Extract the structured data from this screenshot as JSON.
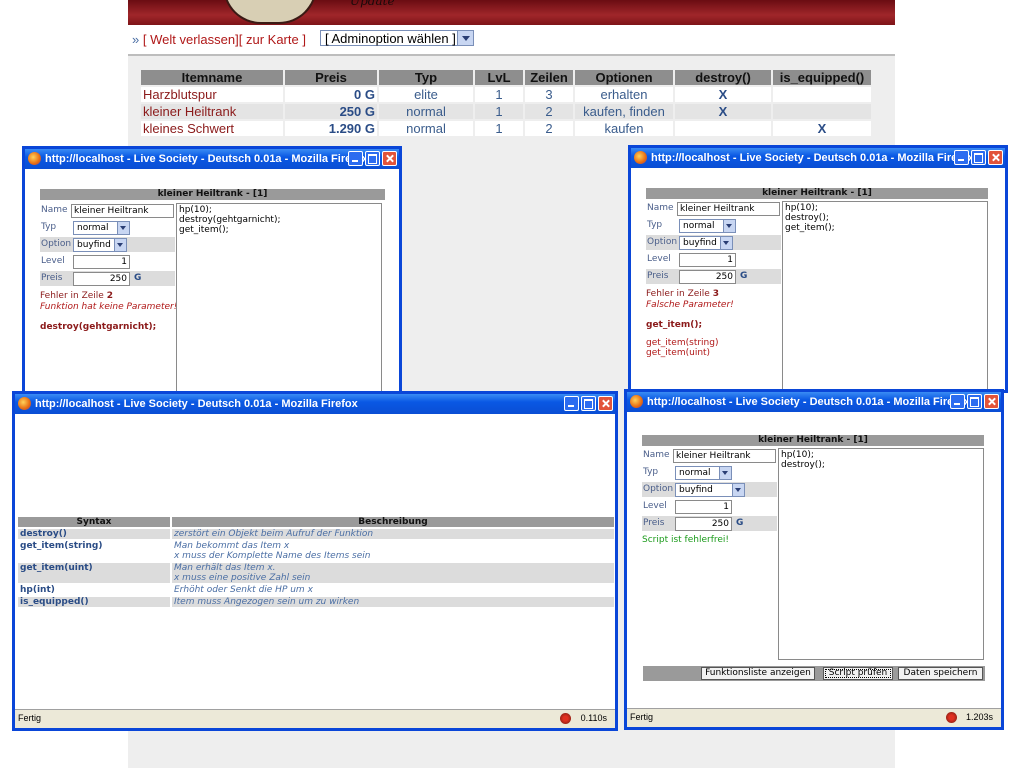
{
  "header": {
    "logo_text": "Update"
  },
  "nav": {
    "prefix": "»",
    "open1": "[",
    "leave_world": "Welt verlassen",
    "sep": "][",
    "to_map": "zur Karte",
    "close1": "]",
    "admin_select": "[ Adminoption wählen ]"
  },
  "items_table": {
    "headers": [
      "Itemname",
      "Preis",
      "Typ",
      "LvL",
      "Zeilen",
      "Optionen",
      "destroy()",
      "is_equipped()"
    ],
    "rows": [
      {
        "name": "Harzblutspur",
        "price": "0 G",
        "type": "elite",
        "lvl": "1",
        "lines": "3",
        "options": "erhalten",
        "destroy": "X",
        "equipped": ""
      },
      {
        "name": "kleiner Heiltrank",
        "price": "250 G",
        "type": "normal",
        "lvl": "1",
        "lines": "2",
        "options": "kaufen, finden",
        "destroy": "X",
        "equipped": ""
      },
      {
        "name": "kleines Schwert",
        "price": "1.290 G",
        "type": "normal",
        "lvl": "1",
        "lines": "2",
        "options": "kaufen",
        "destroy": "",
        "equipped": "X"
      }
    ]
  },
  "window_title": "http://localhost - Live Society - Deutsch 0.01a - Mozilla Firefox",
  "editor": {
    "heading": "kleiner Heiltrank - [1]",
    "labels": {
      "name": "Name",
      "type": "Typ",
      "option": "Option",
      "level": "Level",
      "price": "Preis"
    },
    "name_value": "kleiner Heiltrank",
    "type_value": "normal",
    "option_value": "buyfind",
    "level_value": "1",
    "price_value": "250",
    "currency": "G"
  },
  "win1": {
    "code": "hp(10);\ndestroy(gehtgarnicht);\nget_item();",
    "err_line_prefix": "Fehler in Zeile",
    "err_line_num": "2",
    "err_msg": "Funktion hat keine Parameter!",
    "err_code": "destroy(gehtgarnicht);"
  },
  "win2": {
    "code": "hp(10);\ndestroy();\nget_item();",
    "err_line_prefix": "Fehler in Zeile",
    "err_line_num": "3",
    "err_msg": "Falsche Parameter!",
    "err_code": "get_item();",
    "suggest1": "get_item(string)",
    "suggest2": "get_item(uint)"
  },
  "win3": {
    "headers": [
      "Syntax",
      "Beschreibung"
    ],
    "rows": [
      {
        "syntax": "destroy()",
        "desc1": "zerstört ein Objekt beim Aufruf der Funktion",
        "desc2": ""
      },
      {
        "syntax": "get_item(string)",
        "desc1": "Man bekommt das Item x",
        "desc2": "x muss der Komplette Name des Items sein"
      },
      {
        "syntax": "get_item(uint)",
        "desc1": "Man erhält das Item x.",
        "desc2": "x muss eine positive Zahl sein"
      },
      {
        "syntax": "hp(int)",
        "desc1": "Erhöht oder Senkt die HP um x",
        "desc2": ""
      },
      {
        "syntax": "is_equipped()",
        "desc1": "Item muss Angezogen sein um zu wirken",
        "desc2": ""
      }
    ],
    "status": "Fertig",
    "timer": "0.110s"
  },
  "win4": {
    "code": "hp(10);\ndestroy();",
    "ok_msg": "Script ist fehlerfrei!",
    "btn_functions": "Funktionsliste anzeigen",
    "btn_check": "Script prüfen",
    "btn_save": "Daten speichern",
    "status": "Fertig",
    "timer": "1.203s"
  }
}
